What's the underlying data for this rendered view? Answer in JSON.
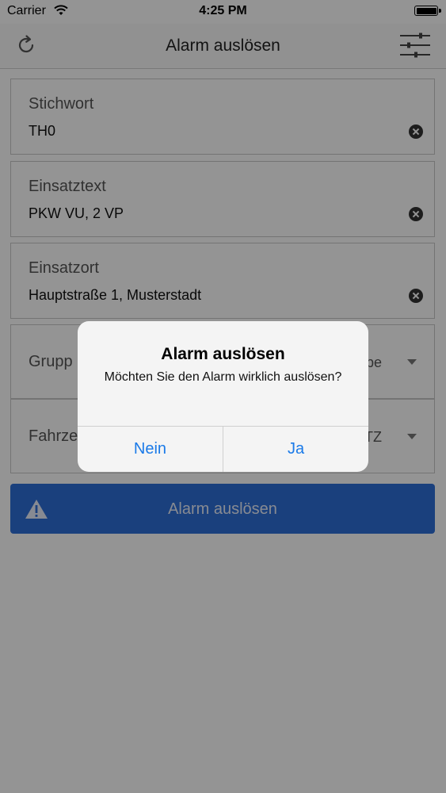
{
  "status_bar": {
    "carrier": "Carrier",
    "time": "4:25 PM"
  },
  "nav": {
    "title": "Alarm auslösen",
    "left_icon": "refresh-icon",
    "right_icon": "sliders-icon"
  },
  "fields": [
    {
      "label": "Stichwort",
      "value": "TH0"
    },
    {
      "label": "Einsatztext",
      "value": "PKW VU, 2 VP"
    },
    {
      "label": "Einsatzort",
      "value": "Hauptstraße 1, Musterstadt"
    }
  ],
  "selects": [
    {
      "label_visible": "Grupp",
      "value_visible": "pe"
    },
    {
      "label_visible": "Fahrze",
      "value_visible": "TZ"
    }
  ],
  "alarm_button": {
    "label": "Alarm auslösen",
    "icon": "warning-icon"
  },
  "dialog": {
    "title": "Alarm auslösen",
    "message": "Möchten Sie den Alarm wirklich auslösen?",
    "cancel": "Nein",
    "confirm": "Ja"
  },
  "colors": {
    "accent": "#2e6fd8",
    "dialog_button": "#1a7ae8",
    "overlay": "rgba(0,0,0,0.42)"
  }
}
